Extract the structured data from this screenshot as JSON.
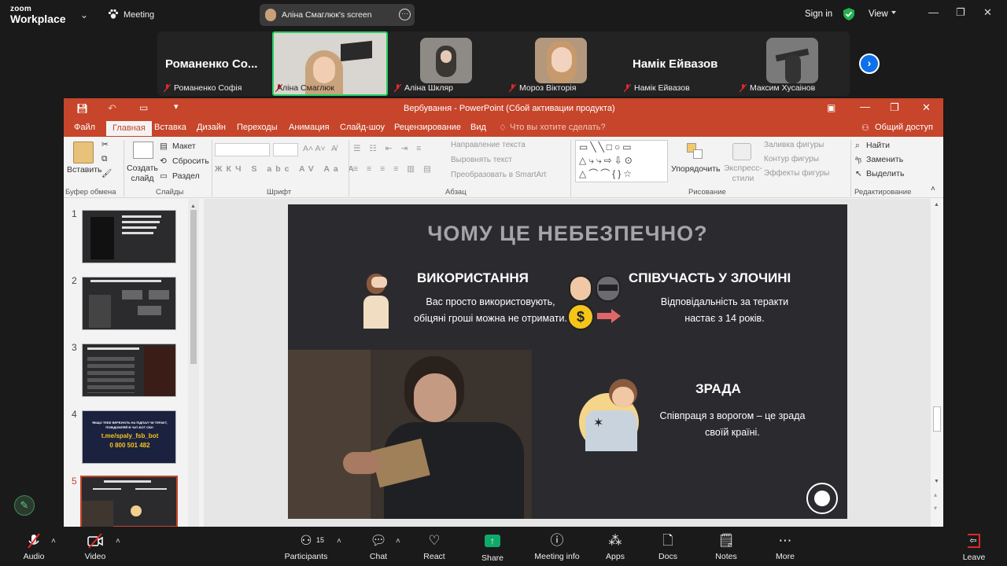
{
  "topbar": {
    "logo_top": "zoom",
    "logo_bottom": "Workplace",
    "meeting_label": "Meeting",
    "share_label": "Аліна Смаглюк's screen",
    "sign_in": "Sign in",
    "view": "View"
  },
  "participants": {
    "big_names": [
      "Романенко Со...",
      "Намік Ейвазов"
    ],
    "names": [
      "Романенко Софія",
      "Аліна Смаглюк",
      "Аліна Шкляр",
      "Мороз Вікторія",
      "Намік Ейвазов",
      "Максим Хусаінов"
    ]
  },
  "ppt": {
    "title": "Вербування - PowerPoint (Сбой активации продукта)",
    "tabs": [
      "Файл",
      "Главная",
      "Вставка",
      "Дизайн",
      "Переходы",
      "Анимация",
      "Слайд-шоу",
      "Рецензирование",
      "Вид"
    ],
    "tell_me": "Что вы хотите сделать?",
    "share": "Общий доступ",
    "ribbon": {
      "paste": "Вставить",
      "clipboard": "Буфер обмена",
      "new_slide": "Создать\nслайд",
      "layout": "Макет",
      "reset": "Сбросить",
      "section": "Раздел",
      "slides_group": "Слайды",
      "font_group": "Шрифт",
      "para_group": "Абзац",
      "text_dir": "Направление текста",
      "align_text": "Выровнять текст",
      "smartart": "Преобразовать в SmartArt",
      "arrange": "Упорядочить",
      "quick_styles": "Экспресс-\nстили",
      "fill": "Заливка фигуры",
      "outline": "Контур фигуры",
      "effects": "Эффекты фигуры",
      "drawing_group": "Рисование",
      "find": "Найти",
      "replace": "Заменить",
      "select": "Выделить",
      "editing_group": "Редактирование"
    },
    "thumb_numbers": [
      "1",
      "2",
      "3",
      "4",
      "5"
    ],
    "thumb4_lines": [
      "ЯКЩО ТЕБЕ ВЕРБУЮТЬ НА ПІДПАЛ ЧИ ТЕРАКТ,",
      "ПОВІДОМЛЯЙ В ЧАТ-БОТ СБУ:",
      "t.me/spaly_fsb_bot",
      "0 800 501 482"
    ],
    "slide": {
      "title": "ЧОМУ ЦЕ НЕБЕЗПЕЧНО?",
      "h1": "ВИКОРИСТАННЯ",
      "t1a": "Вас просто використовують,",
      "t1b": "обіцяні гроші можна не отримати.",
      "h2": "СПІВУЧАСТЬ У ЗЛОЧИНІ",
      "t2a": "Відповідальність за теракти",
      "t2b": "настає з 14 років.",
      "h3": "ЗРАДА",
      "t3a": "Співпраця з ворогом – це зрада",
      "t3b": "своїй країні."
    }
  },
  "bottombar": {
    "audio": "Audio",
    "video": "Video",
    "participants": "Participants",
    "participants_count": "15",
    "chat": "Chat",
    "react": "React",
    "share": "Share",
    "meeting_info": "Meeting info",
    "apps": "Apps",
    "docs": "Docs",
    "notes": "Notes",
    "more": "More",
    "leave": "Leave"
  },
  "colors": {
    "ppt_accent": "#c6452b",
    "zoom_blue": "#0e71eb",
    "share_green": "#0fa968",
    "leave_red": "#e02828"
  }
}
